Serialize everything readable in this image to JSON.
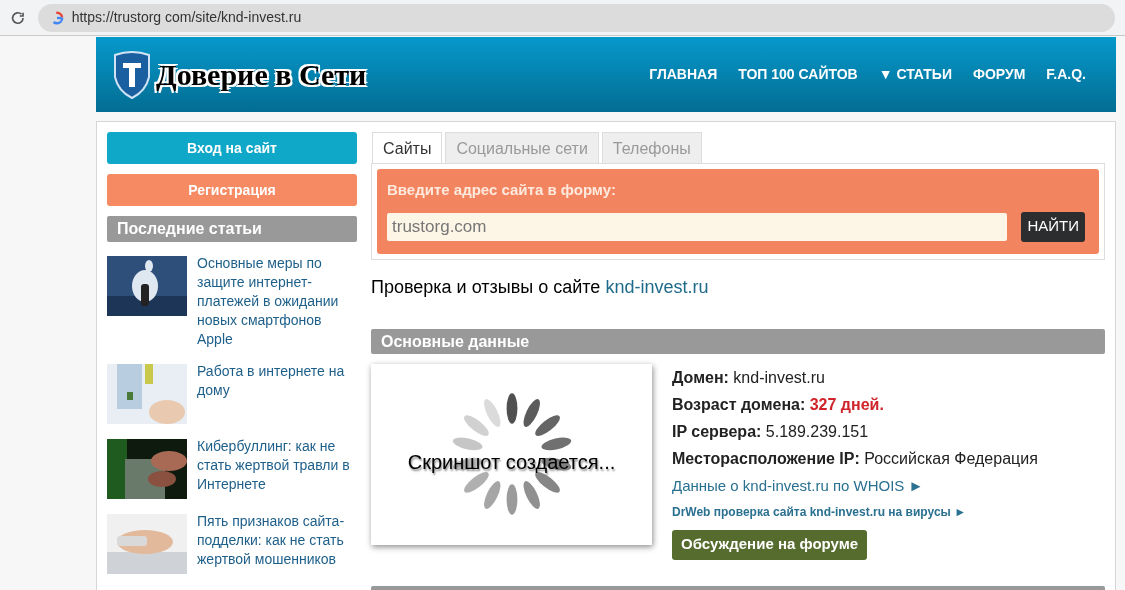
{
  "browser": {
    "url": "https://trustorg com/site/knd-invest.ru"
  },
  "header": {
    "logo_text": "Доверие в Сети",
    "nav": [
      {
        "label": "ГЛАВНАЯ"
      },
      {
        "label": "ТОП 100 САЙТОВ"
      },
      {
        "label": "▼ СТАТЬИ"
      },
      {
        "label": "ФОРУМ"
      },
      {
        "label": "F.A.Q."
      }
    ]
  },
  "sidebar": {
    "buttons": [
      {
        "label": "Вход на сайт",
        "kind": "login"
      },
      {
        "label": "Регистрация",
        "kind": "register"
      }
    ],
    "section_title": "Последние статьи",
    "articles": [
      {
        "title": "Основные меры по защите интернет-платежей в ожидании новых смартфонов Apple"
      },
      {
        "title": "Работа в интернете на дому"
      },
      {
        "title": "Кибербуллинг: как не стать жертвой травли в Интернете"
      },
      {
        "title": "Пять признаков сайта-подделки: как не стать жертвой мошенников"
      }
    ]
  },
  "tabs": [
    {
      "label": "Сайты",
      "selected": true
    },
    {
      "label": "Социальные сети",
      "selected": false
    },
    {
      "label": "Телефоны",
      "selected": false
    }
  ],
  "search": {
    "prompt": "Введите адрес сайта в форму:",
    "placeholder": "trustorg.com",
    "button": "НАЙТИ"
  },
  "heading": {
    "text": "Проверка и отзывы о сайте ",
    "link": "knd-invest.ru"
  },
  "section": {
    "title": "Основные данные",
    "screenshot_caption": "Скриншот создается...",
    "facts": [
      {
        "label": "Домен:",
        "value": "knd-invest.ru",
        "kind": "plain"
      },
      {
        "label": "Возраст домена:",
        "value": "327 дней.",
        "kind": "alert"
      },
      {
        "label": "IP сервера:",
        "value": "5.189.239.151",
        "kind": "plain"
      },
      {
        "label": "Месторасположение IP:",
        "value": "Российская Федерация",
        "kind": "plain"
      }
    ],
    "links": [
      {
        "label": "Данные о knd-invest.ru по WHOIS ►",
        "kind": "large"
      },
      {
        "label": "DrWeb проверка сайта knd-invest.ru на вирусы ►",
        "kind": "small"
      }
    ],
    "forum_button": "Обсуждение на форуме"
  }
}
